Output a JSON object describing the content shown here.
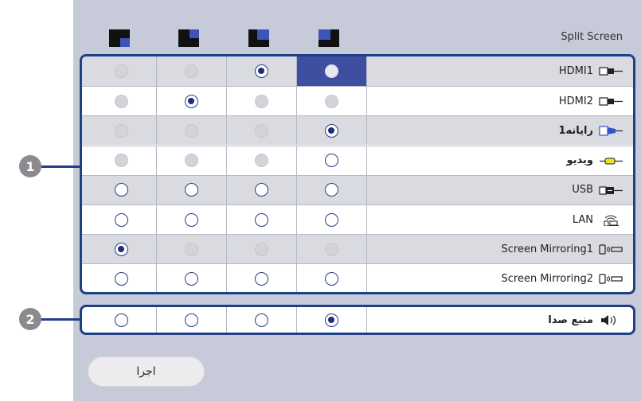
{
  "header": {
    "title": "Split Screen"
  },
  "layouts": [
    {
      "name": "layout-icon-1",
      "icon": "split-layout-bottom-right-icon"
    },
    {
      "name": "layout-icon-2",
      "icon": "split-layout-top-right-icon"
    },
    {
      "name": "layout-icon-3",
      "icon": "split-layout-top-right-large-icon"
    },
    {
      "name": "layout-icon-4",
      "icon": "split-layout-top-left-large-icon"
    }
  ],
  "sources": [
    {
      "label": "HDMI1",
      "icon": "hdmi-icon",
      "states": [
        "dis",
        "dis",
        "on",
        "white-sel"
      ]
    },
    {
      "label": "HDMI2",
      "icon": "hdmi-icon",
      "states": [
        "dis",
        "on",
        "dis",
        "dis"
      ]
    },
    {
      "label": "رایانه1",
      "icon": "vga-computer-icon",
      "states": [
        "dis",
        "dis",
        "dis",
        "on"
      ]
    },
    {
      "label": "ویدیو",
      "icon": "video-icon",
      "states": [
        "dis",
        "dis",
        "dis",
        "empty"
      ]
    },
    {
      "label": "USB",
      "icon": "usb-icon",
      "states": [
        "empty",
        "empty",
        "empty",
        "empty"
      ]
    },
    {
      "label": "LAN",
      "icon": "lan-icon",
      "states": [
        "empty",
        "empty",
        "empty",
        "empty"
      ]
    },
    {
      "label": "Screen Mirroring1",
      "icon": "screen-mirroring-icon",
      "states": [
        "on",
        "dis",
        "dis",
        "dis"
      ]
    },
    {
      "label": "Screen Mirroring2",
      "icon": "screen-mirroring-icon",
      "states": [
        "empty",
        "empty",
        "empty",
        "empty"
      ]
    }
  ],
  "audio": {
    "label": "منبع صدا",
    "icon": "speaker-icon",
    "states": [
      "empty",
      "empty",
      "empty",
      "on"
    ]
  },
  "callouts": {
    "c1": "1",
    "c2": "2"
  },
  "apply_button": {
    "label": "اجرا"
  },
  "colors": {
    "panel": "#c7cad9",
    "accent": "#1f3f86",
    "selected": "#3f4fa0"
  }
}
